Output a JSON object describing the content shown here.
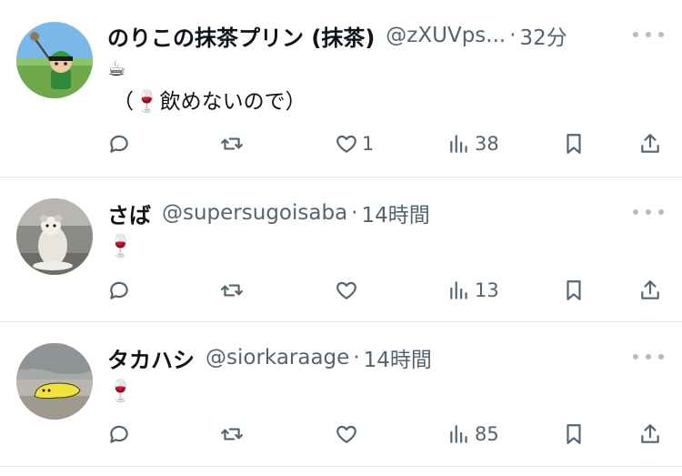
{
  "tweets": [
    {
      "name": "のりこの抹茶プリン (抹茶)",
      "handle": "@zXUVps...",
      "separator": "·",
      "time": "32分",
      "body_line1": "☕",
      "body_line2": "（🍷飲めないので）",
      "replies": "",
      "retweets": "",
      "likes": "1",
      "views": "38",
      "avatar": "green-hat-character-avatar"
    },
    {
      "name": "さば",
      "handle": "@supersugoisaba",
      "separator": "·",
      "time": "14時間",
      "body_line1": "🍷",
      "body_line2": "",
      "replies": "",
      "retweets": "",
      "likes": "",
      "views": "13",
      "avatar": "hamster-avatar"
    },
    {
      "name": "タカハシ",
      "handle": "@siorkaraage",
      "separator": "·",
      "time": "14時間",
      "body_line1": "🍷",
      "body_line2": "",
      "replies": "",
      "retweets": "",
      "likes": "",
      "views": "85",
      "avatar": "yellow-blob-beach-avatar"
    }
  ],
  "icons": {
    "reply": "reply-icon",
    "retweet": "retweet-icon",
    "like": "heart-icon",
    "views": "views-bar-chart-icon",
    "bookmark": "bookmark-icon",
    "share": "share-icon",
    "more": "more-dots-icon"
  },
  "colors": {
    "text": "#0f1419",
    "secondary": "#536471",
    "divider": "#e6e9eb"
  }
}
